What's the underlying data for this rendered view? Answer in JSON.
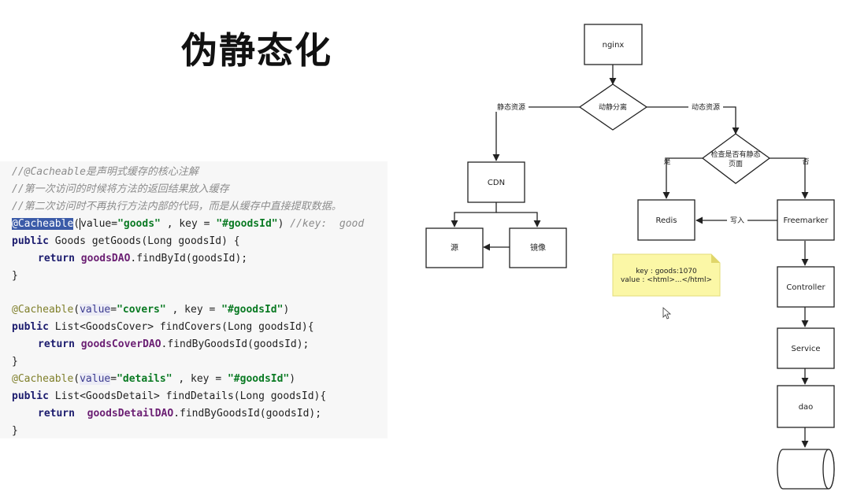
{
  "title": "伪静态化",
  "code": {
    "comments": [
      "//@Cacheable是声明式缓存的核心注解",
      "//第一次访问的时候将方法的返回结果放入缓存",
      "//第二次访问时不再执行方法内部的代码，而是从缓存中直接提取数据。"
    ],
    "blocks": [
      {
        "annotation": "@Cacheable",
        "value_attr": "value",
        "value": "\"goods\"",
        "key_part": " , key = ",
        "key": "\"#goodsId\"",
        "close": ")",
        "trailing_comment": "//key:  good",
        "signature_kw": "public",
        "signature_rest": " Goods getGoods(Long goodsId) {",
        "return_kw": "return",
        "dao": "goodsDAO",
        "call": ".findById(goodsId);",
        "brace": "}"
      },
      {
        "annotation": "@Cacheable",
        "value_attr": "value",
        "value": "\"covers\"",
        "key_part": " , key = ",
        "key": "\"#goodsId\"",
        "close": ")",
        "signature_kw": "public",
        "signature_rest": " List<GoodsCover> findCovers(Long goodsId){",
        "return_kw": "return",
        "dao": "goodsCoverDAO",
        "call": ".findByGoodsId(goodsId);",
        "brace": "}"
      },
      {
        "annotation": "@Cacheable",
        "value_attr": "value",
        "value": "\"details\"",
        "key_part": " , key = ",
        "key": "\"#goodsId\"",
        "close": ")",
        "signature_kw": "public",
        "signature_rest": " List<GoodsDetail> findDetails(Long goodsId){",
        "return_kw": "return ",
        "dao": "goodsDetailDAO",
        "call": ".findByGoodsId(goodsId);",
        "brace": "}"
      }
    ]
  },
  "diagram": {
    "nodes": {
      "nginx": "nginx",
      "dispatch": "动静分离",
      "cdn": "CDN",
      "origin": "源",
      "mirror": "镜像",
      "check_line1": "检查是否有静态",
      "check_line2": "页面",
      "redis": "Redis",
      "freemarker": "Freemarker",
      "controller": "Controller",
      "service": "Service",
      "dao": "dao"
    },
    "edge_labels": {
      "static": "静态资源",
      "dynamic": "动态资源",
      "yes": "是",
      "no": "否",
      "write": "写入"
    },
    "note": {
      "line1": "key : goods:1070",
      "line2": "value : <html>...</html>"
    }
  },
  "colors": {
    "note_fill": "#fbf7a6",
    "annotation_highlight": "#3b5ba8",
    "code_background": "#f7f7f7"
  }
}
